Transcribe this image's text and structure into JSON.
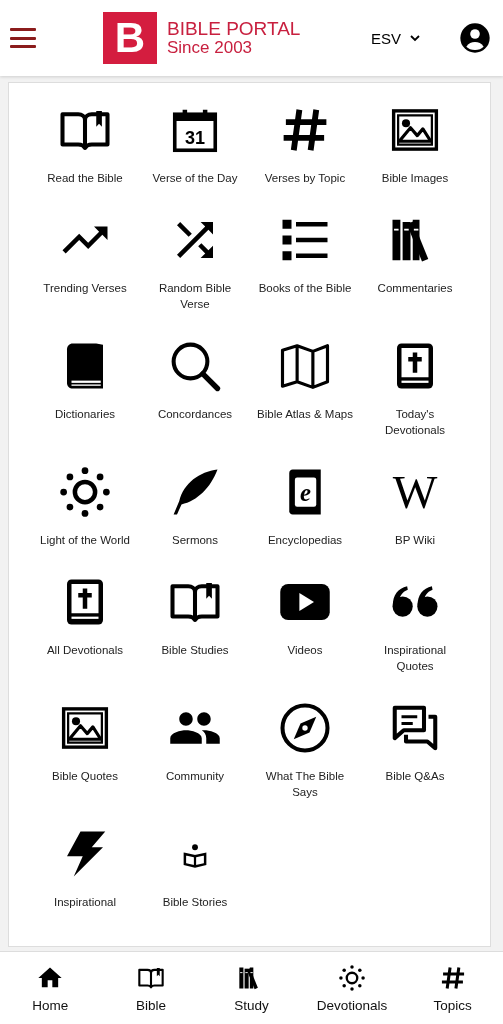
{
  "header": {
    "logo_letter": "B",
    "title": "BIBLE PORTAL",
    "subtitle": "Since 2003",
    "version": "ESV"
  },
  "tiles": [
    {
      "label": "Read the Bible",
      "kind": "book"
    },
    {
      "label": "Verse of the Day",
      "kind": "calendar",
      "icon_text": "31"
    },
    {
      "label": "Verses by Topic",
      "kind": "hash"
    },
    {
      "label": "Bible Images",
      "kind": "image"
    },
    {
      "label": "Trending Verses",
      "kind": "trending"
    },
    {
      "label": "Random Bible Verse",
      "kind": "shuffle"
    },
    {
      "label": "Books of the Bible",
      "kind": "list"
    },
    {
      "label": "Commentaries",
      "kind": "books"
    },
    {
      "label": "Dictionaries",
      "kind": "dictionary"
    },
    {
      "label": "Concordances",
      "kind": "search"
    },
    {
      "label": "Bible Atlas & Maps",
      "kind": "map"
    },
    {
      "label": "Today's Devotionals",
      "kind": "devotional"
    },
    {
      "label": "Light of the World",
      "kind": "sun"
    },
    {
      "label": "Sermons",
      "kind": "feather"
    },
    {
      "label": "Encyclopedias",
      "kind": "encyclopedia",
      "icon_text": "e"
    },
    {
      "label": "BP Wiki",
      "kind": "wiki",
      "icon_text": "W"
    },
    {
      "label": "All Devotionals",
      "kind": "devotional"
    },
    {
      "label": "Bible Studies",
      "kind": "book"
    },
    {
      "label": "Videos",
      "kind": "play"
    },
    {
      "label": "Inspirational Quotes",
      "kind": "quote"
    },
    {
      "label": "Bible Quotes",
      "kind": "image"
    },
    {
      "label": "Community",
      "kind": "people"
    },
    {
      "label": "What The Bible Says",
      "kind": "compass"
    },
    {
      "label": "Bible Q&As",
      "kind": "chat"
    },
    {
      "label": "Inspirational",
      "kind": "bolt"
    },
    {
      "label": "Bible Stories",
      "kind": "reader"
    }
  ],
  "nav": [
    {
      "label": "Home",
      "kind": "home"
    },
    {
      "label": "Bible",
      "kind": "book"
    },
    {
      "label": "Study",
      "kind": "books"
    },
    {
      "label": "Devotionals",
      "kind": "sun"
    },
    {
      "label": "Topics",
      "kind": "hash"
    }
  ]
}
